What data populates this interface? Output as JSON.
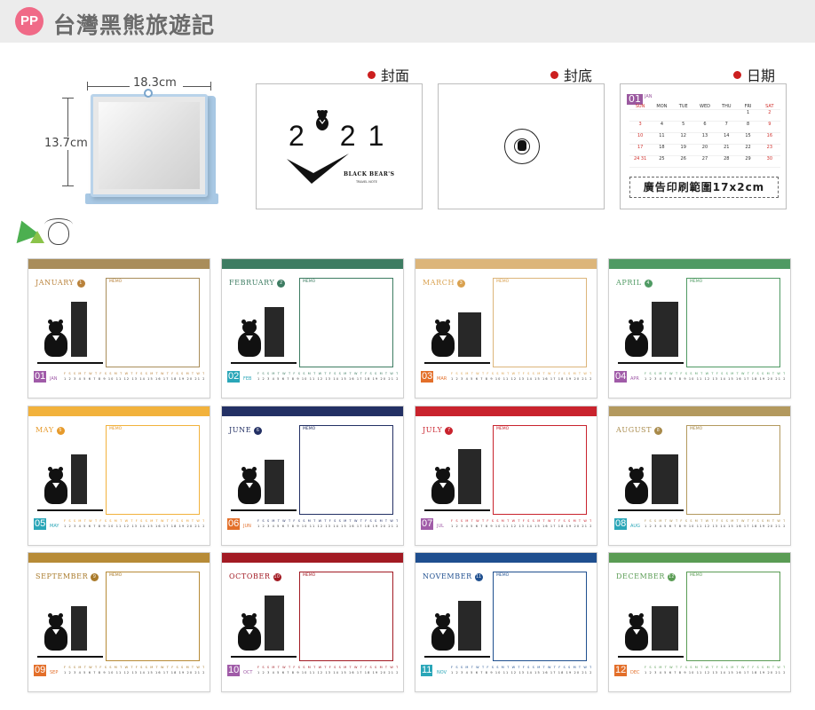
{
  "header": {
    "badge": "PP",
    "title": "台灣黑熊旅遊記"
  },
  "product": {
    "width_label": "18.3cm",
    "height_label": "13.7cm"
  },
  "previews": {
    "cover_label": "封面",
    "back_label": "封底",
    "date_label": "日期",
    "cover_year_digits": [
      "2",
      "2",
      "1"
    ],
    "cover_name": "BLACK BEAR'S",
    "cover_sub": "TRAVEL NOTE",
    "stamp_text": "BLACK BEAR'S TRAVEL NOTE 2021",
    "date_month_num": "01",
    "date_month_abbr": "JAN",
    "weekdays": [
      "SUN",
      "MON",
      "TUE",
      "WED",
      "THU",
      "FRI",
      "SAT"
    ],
    "date_rows": [
      [
        "",
        "",
        "",
        "",
        "",
        "1",
        "2"
      ],
      [
        "3",
        "4",
        "5",
        "6",
        "7",
        "8",
        "9"
      ],
      [
        "10",
        "11",
        "12",
        "13",
        "14",
        "15",
        "16"
      ],
      [
        "17",
        "18",
        "19",
        "20",
        "21",
        "22",
        "23"
      ],
      [
        "24 31",
        "25",
        "26",
        "27",
        "28",
        "29",
        "30"
      ]
    ],
    "ad_area": "廣告印刷範圍17x2cm"
  },
  "calendar": {
    "memo_label": "MEMO",
    "weekday_row": "F S S M T W T F S S M T W T F S S M T W T F S S M T W T F S S",
    "day_row": "1 2 3 4 5 6 7 8 9 10 11 12 13 14 15 16 17 18 19 20 21 22 23 24 25 26 27 28 29 30 31",
    "months": [
      {
        "name": "JANUARY",
        "num": "1",
        "cal_num": "01",
        "abbr": "JAN",
        "color": "#a98d5a",
        "text_color": "#b9823b",
        "num_color": "#a05ba8"
      },
      {
        "name": "FEBRUARY",
        "num": "2",
        "cal_num": "02",
        "abbr": "FEB",
        "color": "#3d7c62",
        "text_color": "#3d7c62",
        "num_color": "#2aa6b8"
      },
      {
        "name": "MARCH",
        "num": "3",
        "cal_num": "03",
        "abbr": "MAR",
        "color": "#dcb57a",
        "text_color": "#d9a14f",
        "num_color": "#e36f2a"
      },
      {
        "name": "APRIL",
        "num": "4",
        "cal_num": "04",
        "abbr": "APR",
        "color": "#4f9a63",
        "text_color": "#4f9a63",
        "num_color": "#a05ba8"
      },
      {
        "name": "MAY",
        "num": "5",
        "cal_num": "05",
        "abbr": "MAY",
        "color": "#f2b23c",
        "text_color": "#e69a2b",
        "num_color": "#2aa6b8"
      },
      {
        "name": "JUNE",
        "num": "6",
        "cal_num": "06",
        "abbr": "JUN",
        "color": "#233064",
        "text_color": "#233064",
        "num_color": "#e36f2a"
      },
      {
        "name": "JULY",
        "num": "7",
        "cal_num": "07",
        "abbr": "JUL",
        "color": "#c9232d",
        "text_color": "#c9232d",
        "num_color": "#a05ba8"
      },
      {
        "name": "AUGUST",
        "num": "8",
        "cal_num": "08",
        "abbr": "AUG",
        "color": "#b3995e",
        "text_color": "#a88a4a",
        "num_color": "#2aa6b8"
      },
      {
        "name": "SEPTEMBER",
        "num": "9",
        "cal_num": "09",
        "abbr": "SEP",
        "color": "#b78b37",
        "text_color": "#a97a2a",
        "num_color": "#e36f2a"
      },
      {
        "name": "OCTOBER",
        "num": "10",
        "cal_num": "10",
        "abbr": "OCT",
        "color": "#a21a23",
        "text_color": "#a21a23",
        "num_color": "#a05ba8"
      },
      {
        "name": "NOVEMBER",
        "num": "11",
        "cal_num": "11",
        "abbr": "NOV",
        "color": "#1f4f8f",
        "text_color": "#1f4f8f",
        "num_color": "#2aa6b8"
      },
      {
        "name": "DECEMBER",
        "num": "12",
        "cal_num": "12",
        "abbr": "DEC",
        "color": "#5a9c54",
        "text_color": "#5a9c54",
        "num_color": "#e36f2a"
      }
    ]
  }
}
